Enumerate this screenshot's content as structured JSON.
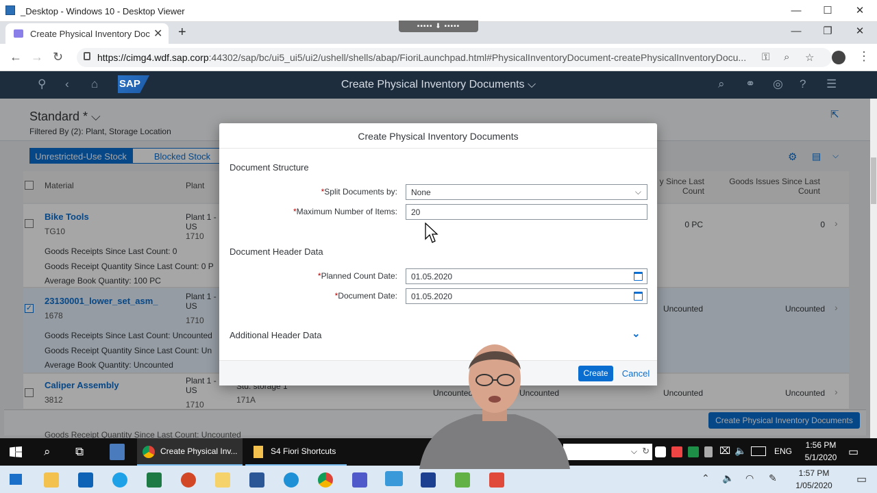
{
  "outer_window": {
    "title": "_Desktop - Windows 10 - Desktop Viewer"
  },
  "browser": {
    "tab_title": "Create Physical Inventory Document",
    "url_host": "https://cimg4.wdf.sap.corp",
    "url_rest": ":44302/sap/bc/ui5_ui5/ui2/ushell/shells/abap/FioriLaunchpad.html#PhysicalInventoryDocument-createPhysicalInventoryDocu..."
  },
  "shell": {
    "title": "Create Physical Inventory Documents ⌵",
    "logo": "SAP"
  },
  "page": {
    "variant": "Standard * ⌵",
    "filtered_by": "Filtered By (2): Plant, Storage Location",
    "segments": [
      "Unrestricted-Use Stock",
      "Blocked Stock"
    ],
    "columns": {
      "material": "Material",
      "plant": "Plant",
      "since_last_count": "y Since Last Count",
      "goods_issues": "Goods Issues Since Last Count"
    },
    "rows": [
      {
        "material": "Bike Tools",
        "sub": "TG10",
        "plant": "Plant 1 - US",
        "plant_code": "1710",
        "details": [
          "Goods Receipts Since Last Count:  0",
          "Goods Receipt Quantity Since Last Count:  0 P",
          "Average Book Quantity:  100 PC"
        ],
        "col_a": "0 PC",
        "col_b": "0"
      },
      {
        "material": "23130001_lower_set_asm_",
        "sub": "1678",
        "plant": "Plant 1 - US",
        "plant_code": "1710",
        "details": [
          "Goods Receipts Since Last Count:  Uncounted",
          "Goods Receipt Quantity Since Last Count:  Un",
          "Average Book Quantity:  Uncounted"
        ],
        "col_a": "Uncounted",
        "col_b": "Uncounted"
      },
      {
        "material": "Caliper Assembly",
        "sub": "3812",
        "plant": "Plant 1 - US",
        "plant_code": "1710",
        "storage": "Std. storage 1",
        "storage_code": "171A",
        "col_c": "Uncounted",
        "col_d": "Uncounted",
        "col_a": "Uncounted",
        "col_b": "Uncounted"
      }
    ],
    "partial_row": "Goods Receipt Quantity Since Last Count:  Uncounted",
    "footer_button": "Create Physical Inventory Documents"
  },
  "dialog": {
    "title": "Create Physical Inventory Documents",
    "section1": "Document Structure",
    "split_label": "Split Documents by:",
    "split_value": "None",
    "max_label": "Maximum Number of Items:",
    "max_value": "20",
    "section2": "Document Header Data",
    "planned_label": "Planned Count Date:",
    "planned_value": "01.05.2020",
    "docdate_label": "Document Date:",
    "docdate_value": "01.05.2020",
    "section3": "Additional Header Data",
    "create": "Create",
    "cancel": "Cancel",
    "required_mark": "*"
  },
  "inner_taskbar": {
    "apps": [
      "Create Physical Inv...",
      "S4 Fiori Shortcuts"
    ],
    "lang": "ENG",
    "time": "1:56 PM",
    "date": "5/1/2020"
  },
  "outer_taskbar": {
    "time": "1:57 PM",
    "date": "1/05/2020"
  },
  "colors": {
    "sap_blue": "#0a6ed1",
    "shell": "#1d2d3e",
    "required": "#bb0000"
  }
}
